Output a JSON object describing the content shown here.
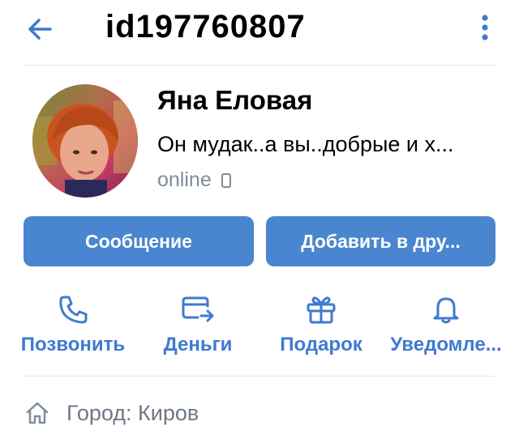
{
  "header": {
    "title": "id197760807"
  },
  "profile": {
    "name": "Яна Еловая",
    "status": "Он мудак..а вы..добрые и х...",
    "online": "online"
  },
  "buttons": {
    "message": "Сообщение",
    "add_friend": "Добавить в дру..."
  },
  "actions": [
    {
      "label": "Позвонить",
      "icon": "phone-icon"
    },
    {
      "label": "Деньги",
      "icon": "money-transfer-icon"
    },
    {
      "label": "Подарок",
      "icon": "gift-icon"
    },
    {
      "label": "Уведомле...",
      "icon": "bell-icon"
    }
  ],
  "info": {
    "city": "Город: Киров",
    "icon": "home-icon"
  },
  "colors": {
    "accent": "#4a86cf",
    "link": "#3f7ad1",
    "secondary_text": "#818c99"
  }
}
